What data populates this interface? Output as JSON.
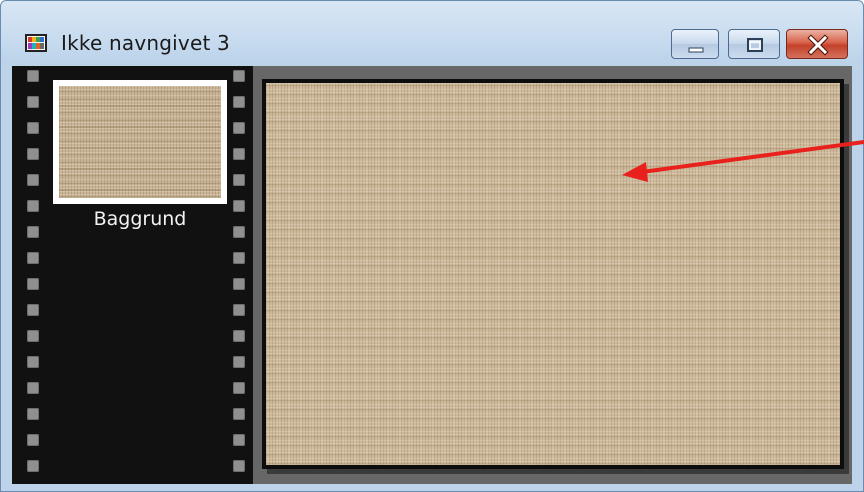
{
  "window": {
    "title": "Ikke navngivet 3",
    "app_icon": "filmstrip-app-icon",
    "controls": {
      "minimize_icon": "minimize-icon",
      "maximize_icon": "maximize-icon",
      "close_icon": "close-icon"
    }
  },
  "layers_panel": {
    "layers": [
      {
        "label": "Baggrund",
        "thumbnail": "burlap-texture"
      }
    ]
  },
  "canvas": {
    "fill": "burlap-texture"
  },
  "annotation": {
    "arrow_color": "#e8211c"
  },
  "colors": {
    "filmstrip": "#111111",
    "workspace": "#676767",
    "canvas_base": "#cdb99a"
  }
}
